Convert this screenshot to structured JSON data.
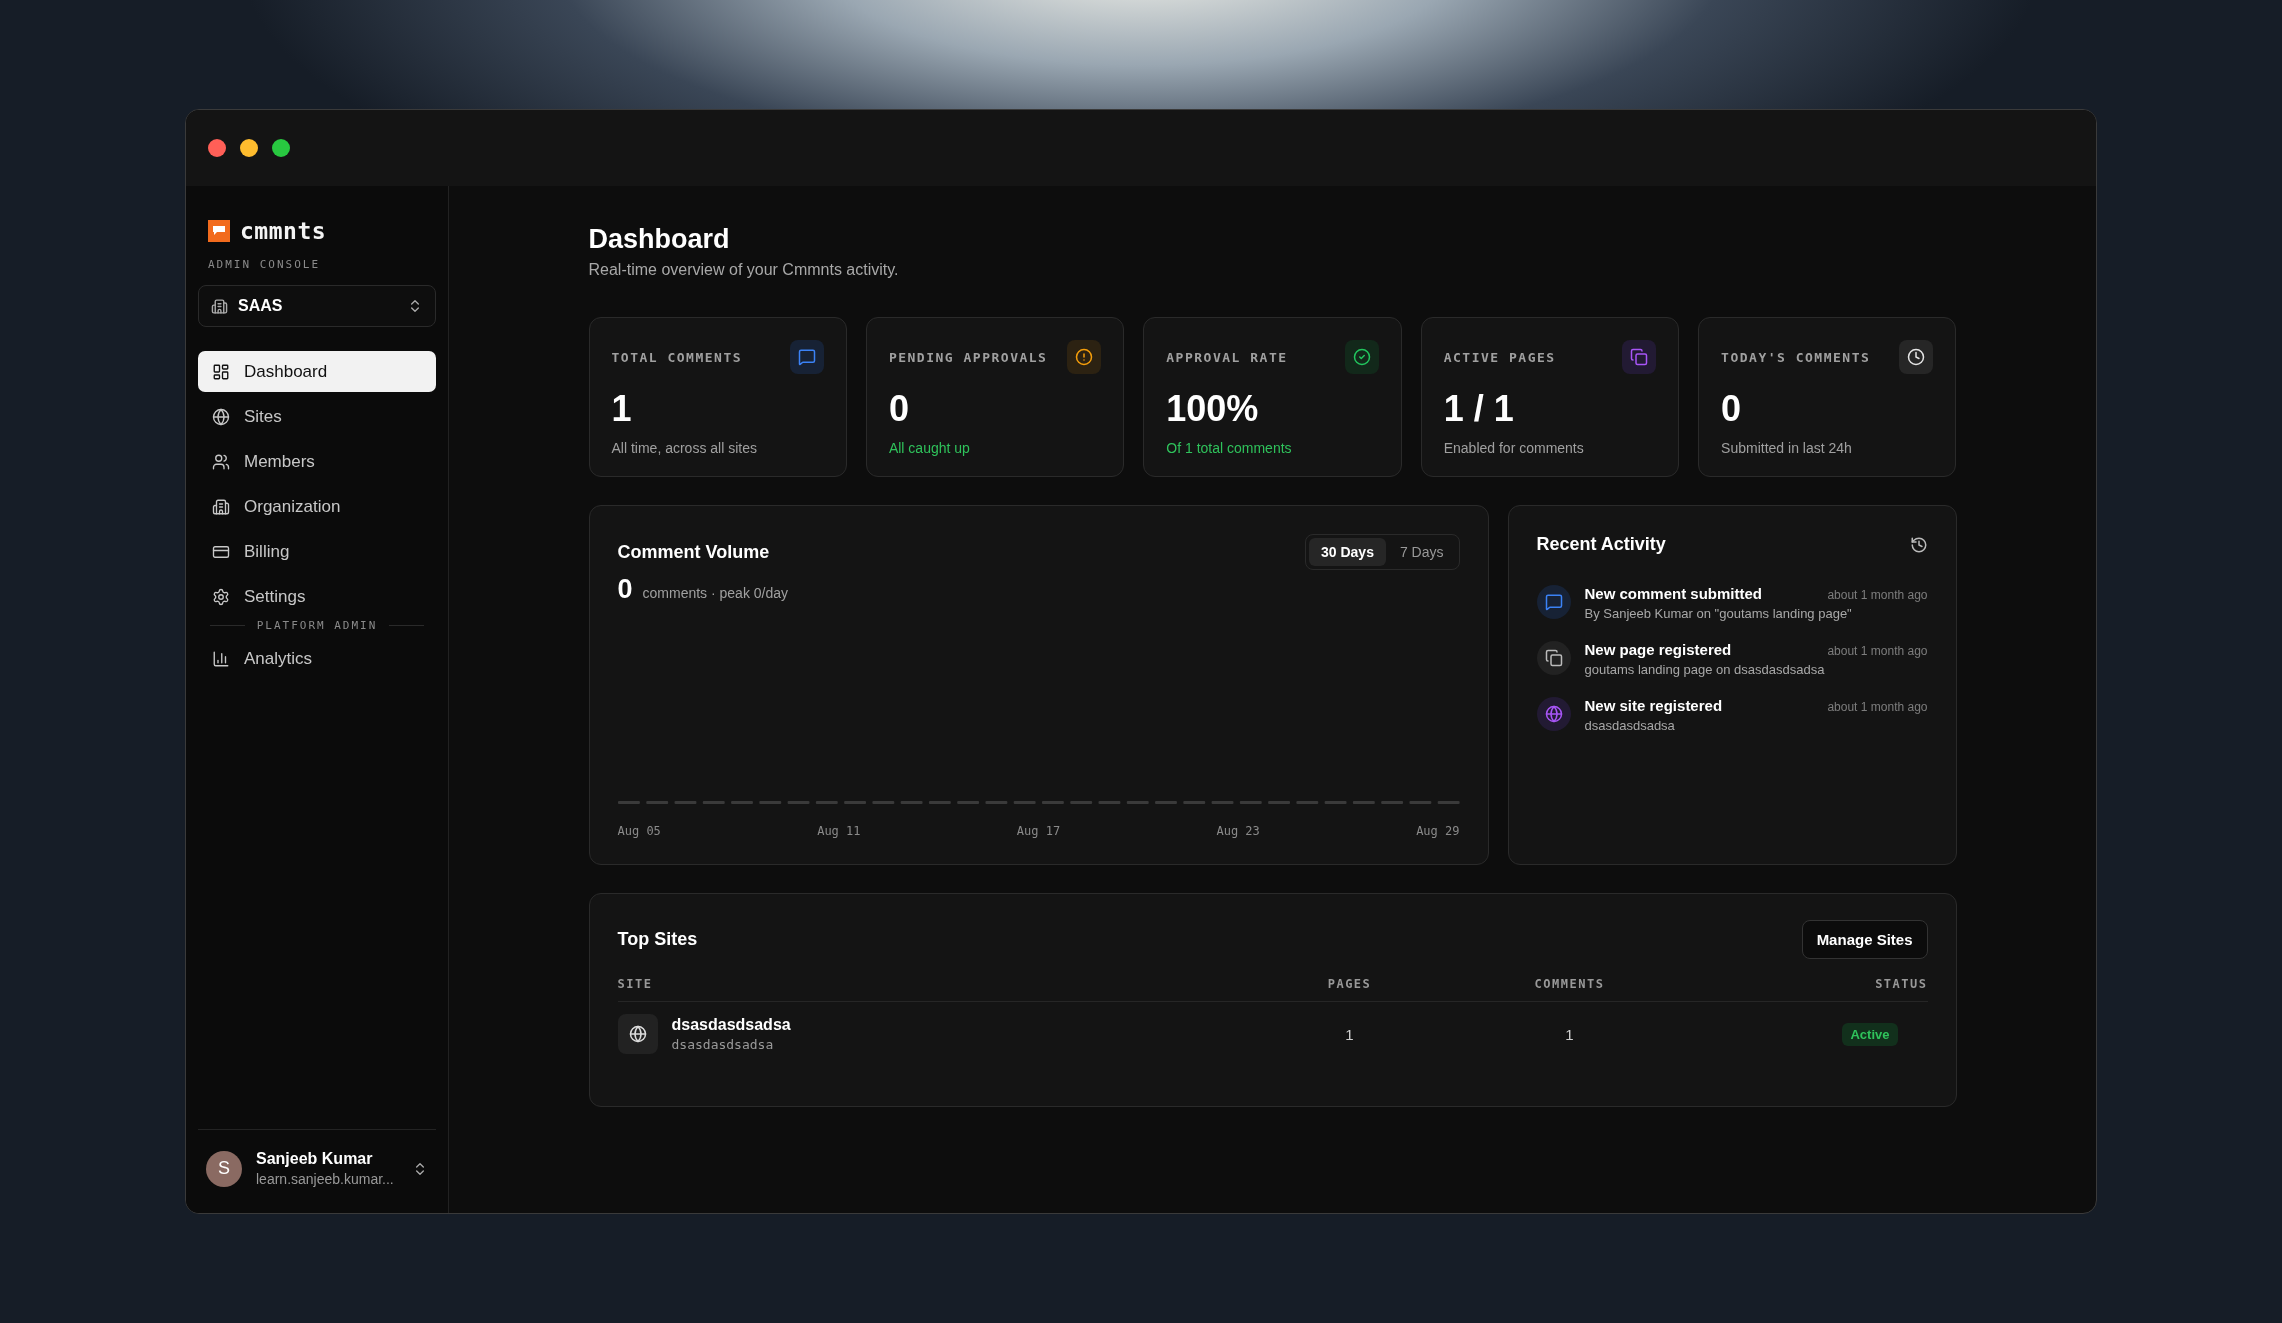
{
  "sidebar": {
    "brand": {
      "name": "cmmnts",
      "subtitle": "ADMIN CONSOLE"
    },
    "workspace": {
      "name": "SAAS"
    },
    "nav": [
      {
        "label": "Dashboard",
        "kind": "dashboard",
        "selected": true
      },
      {
        "label": "Sites",
        "kind": "globe",
        "selected": false
      },
      {
        "label": "Members",
        "kind": "users",
        "selected": false
      },
      {
        "label": "Organization",
        "kind": "building",
        "selected": false
      },
      {
        "label": "Billing",
        "kind": "card",
        "selected": false
      },
      {
        "label": "Settings",
        "kind": "gear",
        "selected": false
      }
    ],
    "section_label": "PLATFORM ADMIN",
    "admin_nav": [
      {
        "label": "Analytics",
        "kind": "chart",
        "selected": false
      }
    ],
    "user": {
      "initial": "S",
      "name": "Sanjeeb Kumar",
      "email": "learn.sanjeeb.kumar..."
    }
  },
  "main": {
    "title": "Dashboard",
    "subtitle": "Real-time overview of your Cmmnts activity.",
    "stats": [
      {
        "label": "TOTAL COMMENTS",
        "value": "1",
        "note": "All time, across all sites",
        "positive": false,
        "kind": "comment"
      },
      {
        "label": "PENDING APPROVALS",
        "value": "0",
        "note": "All caught up",
        "positive": true,
        "kind": "alert"
      },
      {
        "label": "APPROVAL RATE",
        "value": "100%",
        "note": "Of 1 total comments",
        "positive": true,
        "kind": "check"
      },
      {
        "label": "ACTIVE PAGES",
        "value": "1 / 1",
        "note": "Enabled for comments",
        "positive": false,
        "kind": "pages"
      },
      {
        "label": "TODAY'S COMMENTS",
        "value": "0",
        "note": "Submitted in last 24h",
        "positive": false,
        "kind": "clock"
      }
    ],
    "volume": {
      "title": "Comment Volume",
      "total": "0",
      "summary": "comments · peak 0/day",
      "ranges": [
        {
          "label": "30 Days",
          "selected": true
        },
        {
          "label": "7 Days",
          "selected": false
        }
      ],
      "x_labels": [
        "Aug 05",
        "Aug 11",
        "Aug 17",
        "Aug 23",
        "Aug 29"
      ]
    },
    "activity": {
      "title": "Recent Activity",
      "items": [
        {
          "kind": "comment",
          "title": "New comment submitted",
          "detail": "By Sanjeeb Kumar on \"goutams landing page\"",
          "time": "about 1 month ago"
        },
        {
          "kind": "pages",
          "title": "New page registered",
          "detail": "goutams landing page on dsasdasdsadsa",
          "time": "about 1 month ago"
        },
        {
          "kind": "globe",
          "title": "New site registered",
          "detail": "dsasdasdsadsa",
          "time": "about 1 month ago"
        }
      ]
    },
    "top_sites": {
      "title": "Top Sites",
      "action": "Manage Sites",
      "columns": [
        "SITE",
        "PAGES",
        "COMMENTS",
        "STATUS"
      ],
      "rows": [
        {
          "name": "dsasdasdsadsa",
          "domain": "dsasdasdsadsa",
          "pages": "1",
          "comments": "1",
          "status": "Active",
          "active": true
        }
      ]
    }
  }
}
